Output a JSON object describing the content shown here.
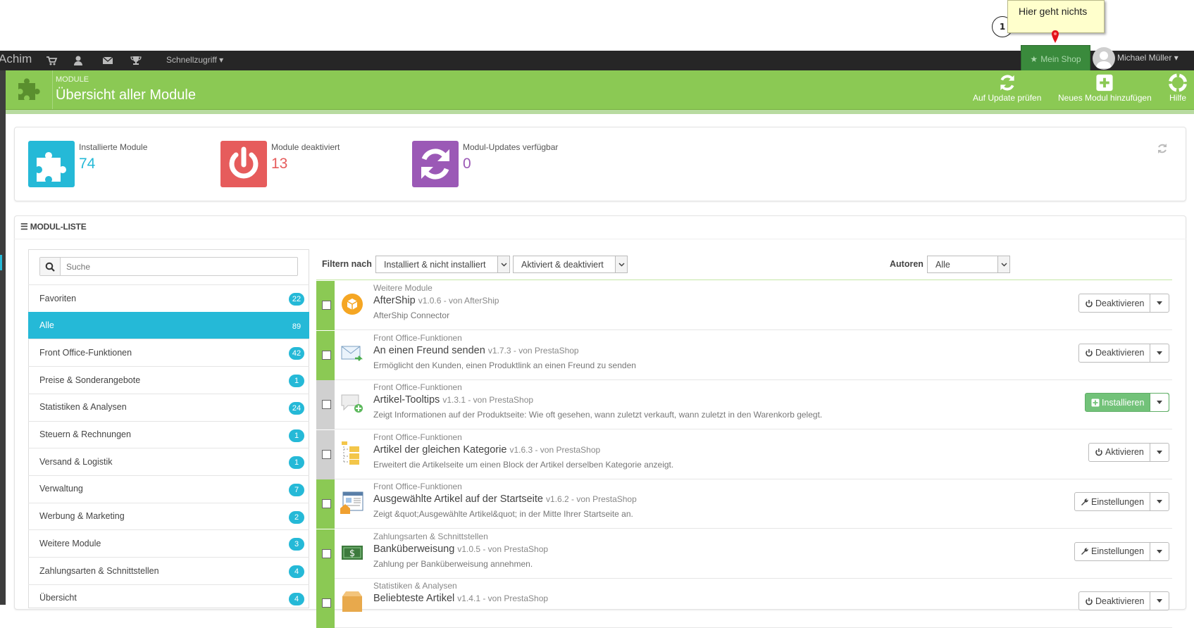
{
  "annotation": {
    "number": "1",
    "text": "Hier geht nichts"
  },
  "topbar": {
    "brand": "Achim",
    "quick_access": "Schnellzugriff",
    "my_shop": "Mein Shop",
    "user_name": "Michael Müller"
  },
  "header": {
    "breadcrumb": "MODULE",
    "title": "Übersicht aller Module",
    "buttons": [
      {
        "label": "Auf Update prüfen",
        "icon": "refresh-icon"
      },
      {
        "label": "Neues Modul hinzufügen",
        "icon": "plus-square-icon"
      },
      {
        "label": "Hilfe",
        "icon": "lifebuoy-icon"
      }
    ]
  },
  "stats": [
    {
      "label": "Installierte Module",
      "value": "74",
      "color": "#25b9d7",
      "icon": "puzzle-icon"
    },
    {
      "label": "Module deaktiviert",
      "value": "13",
      "color": "#e65c5c",
      "icon": "power-icon"
    },
    {
      "label": "Modul-Updates verfügbar",
      "value": "0",
      "color": "#9b59b6",
      "icon": "refresh-icon"
    }
  ],
  "module_list": {
    "heading": "MODUL-LISTE",
    "search_placeholder": "Suche",
    "categories": [
      {
        "label": "Favoriten",
        "count": "22"
      },
      {
        "label": "Alle",
        "count": "89",
        "active": true
      },
      {
        "label": "Front Office-Funktionen",
        "count": "42"
      },
      {
        "label": "Preise & Sonderangebote",
        "count": "1"
      },
      {
        "label": "Statistiken & Analysen",
        "count": "24"
      },
      {
        "label": "Steuern & Rechnungen",
        "count": "1"
      },
      {
        "label": "Versand & Logistik",
        "count": "1"
      },
      {
        "label": "Verwaltung",
        "count": "7"
      },
      {
        "label": "Werbung & Marketing",
        "count": "2"
      },
      {
        "label": "Weitere Module",
        "count": "3"
      },
      {
        "label": "Zahlungsarten & Schnittstellen",
        "count": "4"
      },
      {
        "label": "Übersicht",
        "count": "4"
      }
    ],
    "filter_label": "Filtern nach",
    "filter_install": "Installiert & nicht installiert",
    "filter_status": "Aktiviert & deaktiviert",
    "authors_label": "Autoren",
    "authors_value": "Alle",
    "modules": [
      {
        "category": "Weitere Module",
        "name": "AfterShip",
        "version": "v1.0.6 - von AfterShip",
        "description": "AfterShip Connector",
        "action": "Deaktivieren",
        "action_icon": "power-icon",
        "status": "active",
        "icon": "aftership-icon"
      },
      {
        "category": "Front Office-Funktionen",
        "name": "An einen Freund senden",
        "version": "v1.7.3 - von PrestaShop",
        "description": "Ermöglicht den Kunden, einen Produktlink an einen Freund zu senden",
        "action": "Deaktivieren",
        "action_icon": "power-icon",
        "status": "active",
        "icon": "mail-forward-icon"
      },
      {
        "category": "Front Office-Funktionen",
        "name": "Artikel-Tooltips",
        "version": "v1.3.1 - von PrestaShop",
        "description": "Zeigt Informationen auf der Produktseite: Wie oft gesehen, wann zuletzt verkauft, wann zuletzt in den Warenkorb gelegt.",
        "action": "Installieren",
        "action_icon": "plus-icon",
        "status": "not-installed",
        "icon": "tooltip-add-icon"
      },
      {
        "category": "Front Office-Funktionen",
        "name": "Artikel der gleichen Kategorie",
        "version": "v1.6.3 - von PrestaShop",
        "description": "Erweitert die Artikelseite um einen Block der Artikel derselben Kategorie anzeigt.",
        "action": "Aktivieren",
        "action_icon": "power-icon",
        "status": "disabled",
        "icon": "folder-tree-icon"
      },
      {
        "category": "Front Office-Funktionen",
        "name": "Ausgewählte Artikel auf der Startseite",
        "version": "v1.6.2 - von PrestaShop",
        "description": "Zeigt &quot;Ausgewählte Artikel&quot; in der Mitte Ihrer Startseite an.",
        "action": "Einstellungen",
        "action_icon": "wrench-icon",
        "status": "active",
        "icon": "homepage-icon"
      },
      {
        "category": "Zahlungsarten & Schnittstellen",
        "name": "Banküberweisung",
        "version": "v1.0.5 - von PrestaShop",
        "description": "Zahlung per Banküberweisung annehmen.",
        "action": "Einstellungen",
        "action_icon": "wrench-icon",
        "status": "active",
        "icon": "banknote-icon"
      },
      {
        "category": "Statistiken & Analysen",
        "name": "Beliebteste Artikel",
        "version": "v1.4.1 - von PrestaShop",
        "description": "",
        "action": "Deaktivieren",
        "action_icon": "power-icon",
        "status": "active",
        "icon": "box-icon"
      }
    ]
  },
  "colors": {
    "header_green": "#8bc954",
    "status_active": "#8bc954",
    "status_disabled": "#d0d0d0",
    "accent_blue": "#25b9d7",
    "install_green": "#72c279"
  }
}
